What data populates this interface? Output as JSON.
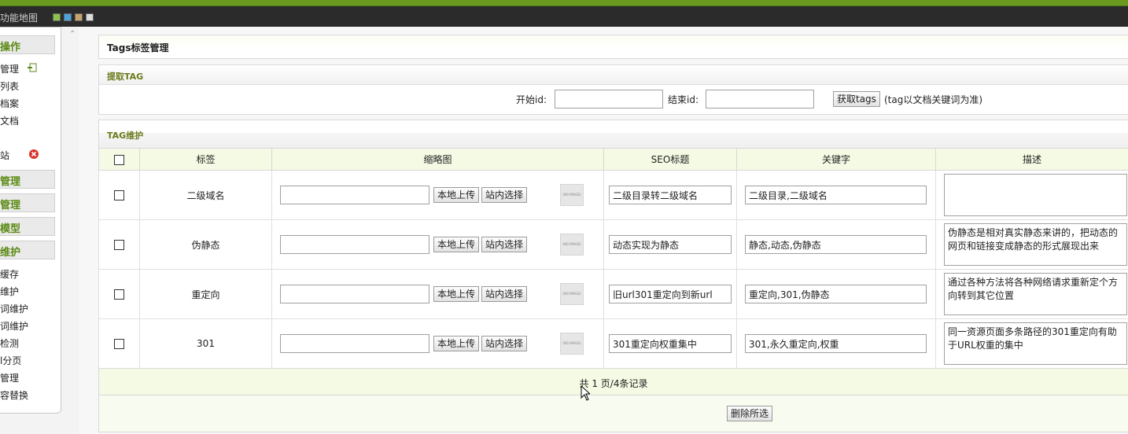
{
  "topbar": {
    "map_label": "功能地图",
    "swatches": [
      "#8bc34a",
      "#4aa3df",
      "#c8a26b",
      "#dddddd"
    ]
  },
  "sidebar": {
    "heads": [
      "操作",
      "管理",
      "管理",
      "模型",
      "维护"
    ],
    "items_top": [
      "管理",
      "列表",
      "档案",
      "文档",
      "站"
    ],
    "items_bottom": [
      "缓存",
      "维护",
      "词维护",
      "词维护",
      "检测",
      "l分页",
      "管理",
      "容替换"
    ]
  },
  "page": {
    "title": "Tags标签管理"
  },
  "extract": {
    "title": "提取TAG",
    "start_label": "开始id:",
    "start_value": "",
    "end_label": "结束id:",
    "end_value": "",
    "fetch_button": "获取tags",
    "note": "(tag以文档关键词为准)"
  },
  "maintain": {
    "title": "TAG维护",
    "columns": [
      "标签",
      "缩略图",
      "SEO标题",
      "关键字",
      "描述"
    ],
    "upload_button": "本地上传",
    "select_button": "站内选择",
    "thumb_text": "(NO IMAGE)",
    "rows": [
      {
        "tag": "二级域名",
        "thumb": "",
        "seo": "二级目录转二级域名",
        "keywords": "二级目录,二级域名",
        "desc": ""
      },
      {
        "tag": "伪静态",
        "thumb": "",
        "seo": "动态实现为静态",
        "keywords": "静态,动态,伪静态",
        "desc": "伪静态是相对真实静态来讲的，把动态的网页和链接变成静态的形式展现出来"
      },
      {
        "tag": "重定向",
        "thumb": "",
        "seo": "旧url301重定向到新url",
        "keywords": "重定向,301,伪静态",
        "desc": "通过各种方法将各种网络请求重新定个方向转到其它位置"
      },
      {
        "tag": "301",
        "thumb": "",
        "seo": "301重定向权重集中",
        "keywords": "301,永久重定向,权重",
        "desc": "同一资源页面多条路径的301重定向有助于URL权重的集中"
      }
    ],
    "pager": "共 1 页/4条记录",
    "delete_button": "删除所选"
  }
}
